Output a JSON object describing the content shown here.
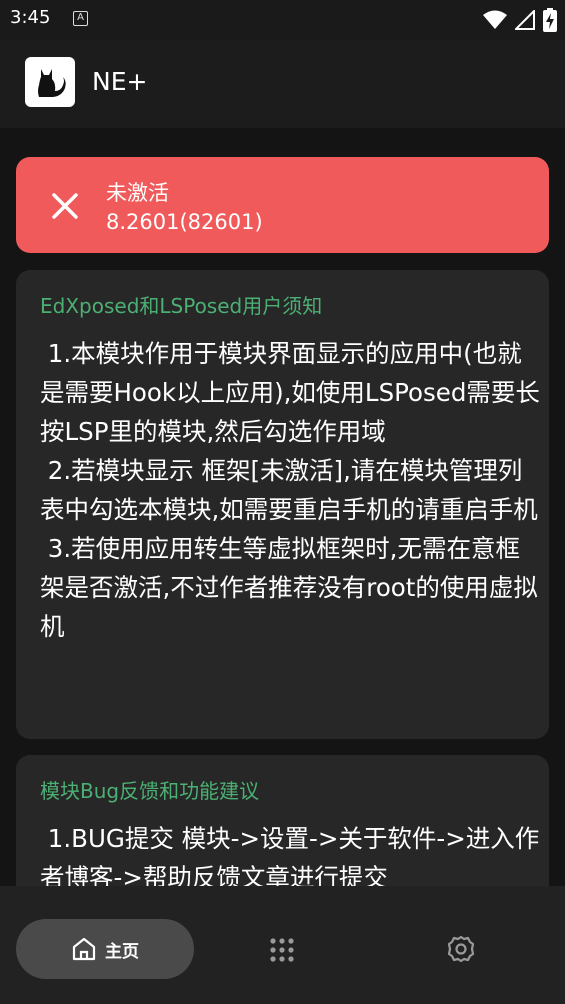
{
  "status_bar": {
    "time": "3:45",
    "indicator": "A",
    "icons": [
      "wifi-icon",
      "signal-icon",
      "battery-charging-icon"
    ]
  },
  "app_bar": {
    "title": "NE+",
    "logo": "cat-logo"
  },
  "activation": {
    "status": "未激活",
    "version": "8.2601(82601)",
    "icon": "close-icon",
    "color": "#f05a5a"
  },
  "cards": [
    {
      "title": "EdXposed和LSPosed用户须知",
      "body": " 1.本模块作用于模块界面显示的应用中(也就是需要Hook以上应用),如使用LSPosed需要长按LSP里的模块,然后勾选作用域\n 2.若模块显示 框架[未激活],请在模块管理列表中勾选本模块,如需要重启手机的请重启手机\n 3.若使用应用转生等虚拟框架时,无需在意框架是否激活,不过作者推荐没有root的使用虚拟机"
    },
    {
      "title": "模块Bug反馈和功能建议",
      "body": " 1.BUG提交 模块->设置->关于软件->进入作者博客->帮助反馈文章进行提交"
    }
  ],
  "bottom_nav": {
    "home_label": "主页",
    "items": [
      "home-icon",
      "apps-grid-icon",
      "settings-icon"
    ]
  },
  "colors": {
    "accent_green": "#4caf73",
    "card_bg": "#272727",
    "background": "#141414"
  }
}
